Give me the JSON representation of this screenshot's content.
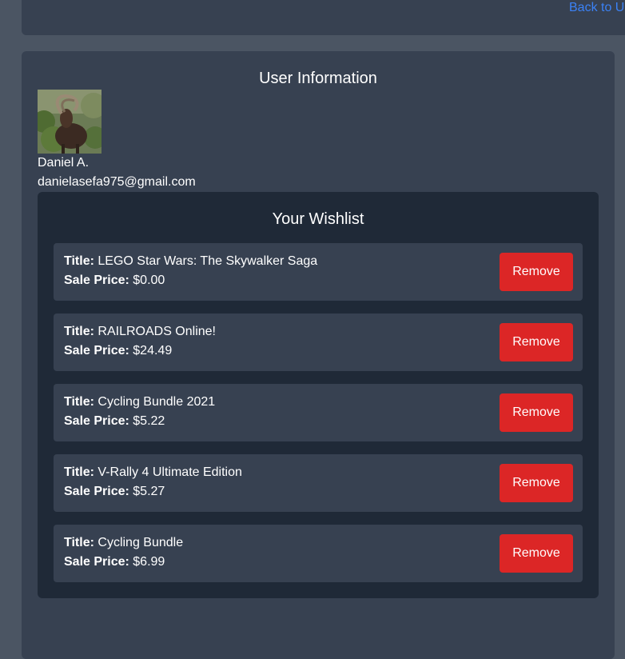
{
  "nav": {
    "back_label": "Back to U"
  },
  "user_info": {
    "heading": "User Information",
    "name": "Daniel A.",
    "email": "danielasefa975@gmail.com",
    "avatar_icon": "ibex-photo-avatar"
  },
  "wishlist": {
    "heading": "Your Wishlist",
    "title_label": "Title:",
    "price_label": "Sale Price:",
    "remove_label": "Remove",
    "items": [
      {
        "title": "LEGO Star Wars: The Skywalker Saga",
        "price": "$0.00"
      },
      {
        "title": "RAILROADS Online!",
        "price": "$24.49"
      },
      {
        "title": "Cycling Bundle 2021",
        "price": "$5.22"
      },
      {
        "title": "V-Rally 4 Ultimate Edition",
        "price": "$5.27"
      },
      {
        "title": "Cycling Bundle",
        "price": "$6.99"
      }
    ]
  },
  "colors": {
    "page_bg": "#4b5563",
    "card_bg": "#374151",
    "wishlist_bg": "#1f2937",
    "remove_button": "#dc2626",
    "link": "#3b82f6"
  }
}
